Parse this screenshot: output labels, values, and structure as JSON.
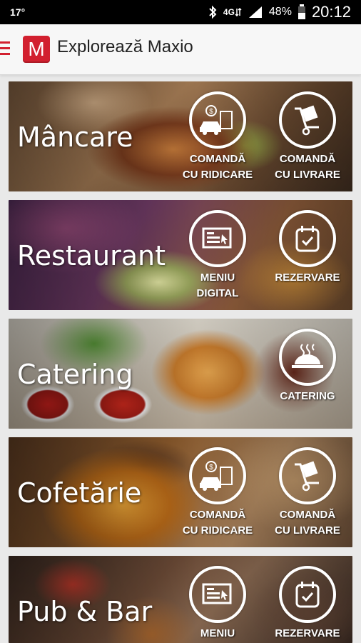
{
  "status_bar": {
    "left_text": "17°",
    "network": "4G",
    "battery": "48%",
    "time": "20:12"
  },
  "app_bar": {
    "logo_letter": "M",
    "title": "Explorează Maxio",
    "accent_color": "#d2202f"
  },
  "cards": [
    {
      "title": "Mâncare",
      "actions": [
        {
          "label_line1": "COMANDĂ",
          "label_line2": "CU RIDICARE",
          "icon": "pickup-order-icon"
        },
        {
          "label_line1": "COMANDĂ",
          "label_line2": "CU LIVRARE",
          "icon": "delivery-cart-icon"
        }
      ]
    },
    {
      "title": "Restaurant",
      "actions": [
        {
          "label_line1": "MENIU",
          "label_line2": "DIGITAL",
          "icon": "digital-menu-icon"
        },
        {
          "label_line1": "REZERVARE",
          "label_line2": "",
          "icon": "calendar-check-icon"
        }
      ]
    },
    {
      "title": "Catering",
      "actions": [
        {
          "label_line1": "CATERING",
          "label_line2": "",
          "icon": "cloche-icon"
        }
      ]
    },
    {
      "title": "Cofetărie",
      "actions": [
        {
          "label_line1": "COMANDĂ",
          "label_line2": "CU RIDICARE",
          "icon": "pickup-order-icon"
        },
        {
          "label_line1": "COMANDĂ",
          "label_line2": "CU LIVRARE",
          "icon": "delivery-cart-icon"
        }
      ]
    },
    {
      "title": "Pub & Bar",
      "actions": [
        {
          "label_line1": "MENIU",
          "label_line2": "",
          "icon": "digital-menu-icon"
        },
        {
          "label_line1": "REZERVARE",
          "label_line2": "",
          "icon": "calendar-check-icon"
        }
      ]
    }
  ]
}
